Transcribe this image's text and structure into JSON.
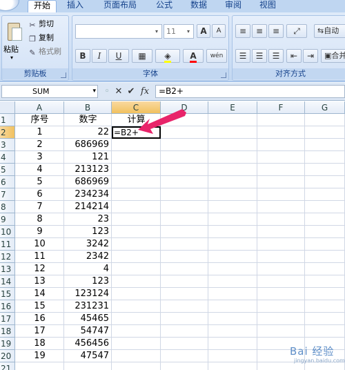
{
  "ribbon": {
    "tabs": [
      {
        "label": "开始",
        "active": true
      },
      {
        "label": "插入",
        "active": false
      },
      {
        "label": "页面布局",
        "active": false
      },
      {
        "label": "公式",
        "active": false
      },
      {
        "label": "数据",
        "active": false
      },
      {
        "label": "审阅",
        "active": false
      },
      {
        "label": "视图",
        "active": false
      }
    ],
    "clipboard": {
      "paste_label": "粘贴",
      "cut_label": "剪切",
      "copy_label": "复制",
      "format_painter_label": "格式刷",
      "group_label": "剪贴板"
    },
    "font": {
      "font_name": "",
      "font_size": "11",
      "bold": "B",
      "italic": "I",
      "underline": "U",
      "grow": "A",
      "shrink": "A",
      "phonetic": "wén",
      "group_label": "字体"
    },
    "alignment": {
      "wrap_label": "自动",
      "merge_label": "合并",
      "group_label": "对齐方式"
    }
  },
  "formula_bar": {
    "name_box": "SUM",
    "formula": "=B2+"
  },
  "sheet": {
    "columns": [
      "A",
      "B",
      "C",
      "D",
      "E",
      "F",
      "G"
    ],
    "rows": [
      "1",
      "2",
      "3",
      "4",
      "5",
      "6",
      "7",
      "8",
      "9",
      "10",
      "11",
      "12",
      "13",
      "14",
      "15",
      "16",
      "17",
      "18",
      "19",
      "20",
      "21"
    ],
    "headers": {
      "a": "序号",
      "b": "数字",
      "c": "计算"
    },
    "data": [
      {
        "a": "1",
        "b": "22"
      },
      {
        "a": "2",
        "b": "686969"
      },
      {
        "a": "3",
        "b": "121"
      },
      {
        "a": "4",
        "b": "213123"
      },
      {
        "a": "5",
        "b": "686969"
      },
      {
        "a": "6",
        "b": "234234"
      },
      {
        "a": "7",
        "b": "214214"
      },
      {
        "a": "8",
        "b": "23"
      },
      {
        "a": "9",
        "b": "123"
      },
      {
        "a": "10",
        "b": "3242"
      },
      {
        "a": "11",
        "b": "2342"
      },
      {
        "a": "12",
        "b": "4"
      },
      {
        "a": "13",
        "b": "123"
      },
      {
        "a": "14",
        "b": "123124"
      },
      {
        "a": "15",
        "b": "231231"
      },
      {
        "a": "16",
        "b": "45465"
      },
      {
        "a": "17",
        "b": "54747"
      },
      {
        "a": "18",
        "b": "456456"
      },
      {
        "a": "19",
        "b": "47547"
      }
    ],
    "active_cell_value": "=B2+"
  },
  "colors": {
    "arrow": "#e8246a",
    "active_header": "#f1c15f"
  },
  "watermark": {
    "text": "Bai 经验",
    "sub": "jingyan.baidu.com"
  }
}
